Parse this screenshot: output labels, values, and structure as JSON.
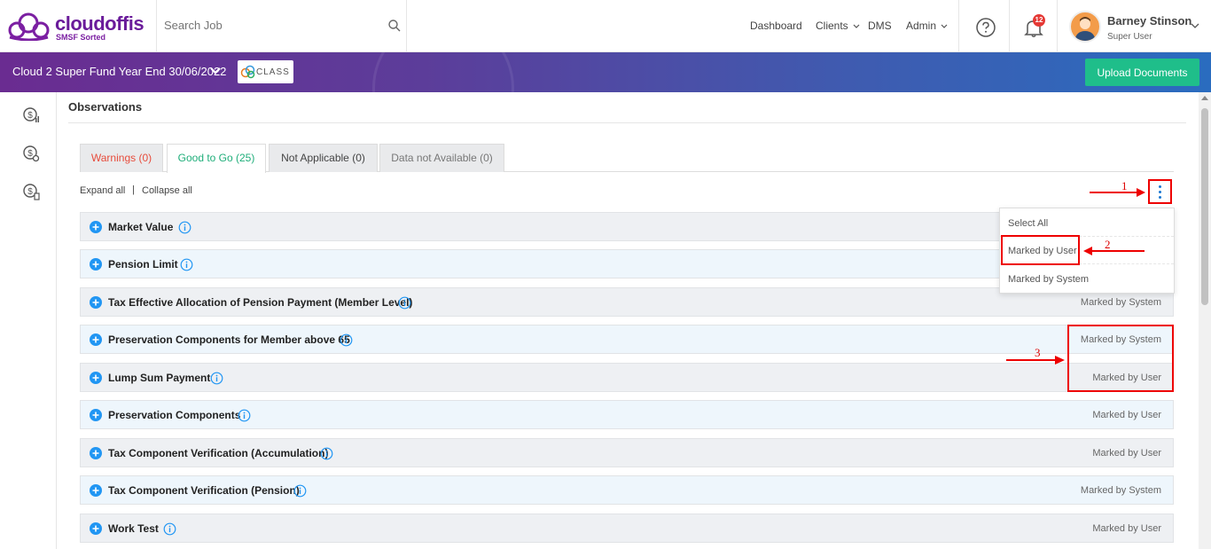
{
  "header": {
    "brand_name": "cloudoffis",
    "brand_tagline": "SMSF Sorted",
    "search_placeholder": "Search Job",
    "nav": [
      {
        "label": "Dashboard"
      },
      {
        "label": "Clients"
      },
      {
        "label": "DMS"
      },
      {
        "label": "Admin"
      }
    ],
    "notification_count": "12",
    "user_name": "Barney Stinson",
    "user_role": "Super User"
  },
  "banner": {
    "fund_title": "Cloud 2 Super Fund Year End 30/06/2022",
    "class_logo_text": "CLASS",
    "upload_label": "Upload Documents"
  },
  "sidebar": {
    "icons": [
      "dollar-chart-icon",
      "dollar-gear-icon",
      "dollar-report-icon"
    ]
  },
  "panel": {
    "title": "Observations",
    "tabs": [
      {
        "label": "Warnings (0)",
        "color": "#e74c3c"
      },
      {
        "label": "Good to Go (25)",
        "color": "#1fae7a"
      },
      {
        "label": "Not Applicable (0)",
        "color": "#444444"
      },
      {
        "label": "Data not Available (0)",
        "color": "#777777"
      }
    ],
    "expand_all": "Expand all",
    "separator": "|",
    "collapse_all": "Collapse all"
  },
  "dropdown": {
    "items": [
      "Select All",
      "Marked by User",
      "Marked by System"
    ]
  },
  "rows": [
    {
      "label": "Market Value",
      "status": ""
    },
    {
      "label": "Pension Limit",
      "status": ""
    },
    {
      "label": "Tax Effective Allocation of Pension Payment (Member Level)",
      "status": "Marked by System"
    },
    {
      "label": "Preservation Components for Member above 65",
      "status": "Marked by System"
    },
    {
      "label": "Lump Sum Payment",
      "status": "Marked by User"
    },
    {
      "label": "Preservation Components",
      "status": "Marked by User"
    },
    {
      "label": "Tax Component Verification (Accumulation)",
      "status": "Marked by User"
    },
    {
      "label": "Tax Component Verification (Pension)",
      "status": "Marked by System"
    },
    {
      "label": "Work Test",
      "status": "Marked by User"
    }
  ],
  "annotations": {
    "one": "1",
    "two": "2",
    "three": "3",
    "color": "#dd0000"
  },
  "colors": {
    "brand": "#6a1b9a",
    "upload": "#1fbe8a",
    "accent": "#2196f3"
  }
}
